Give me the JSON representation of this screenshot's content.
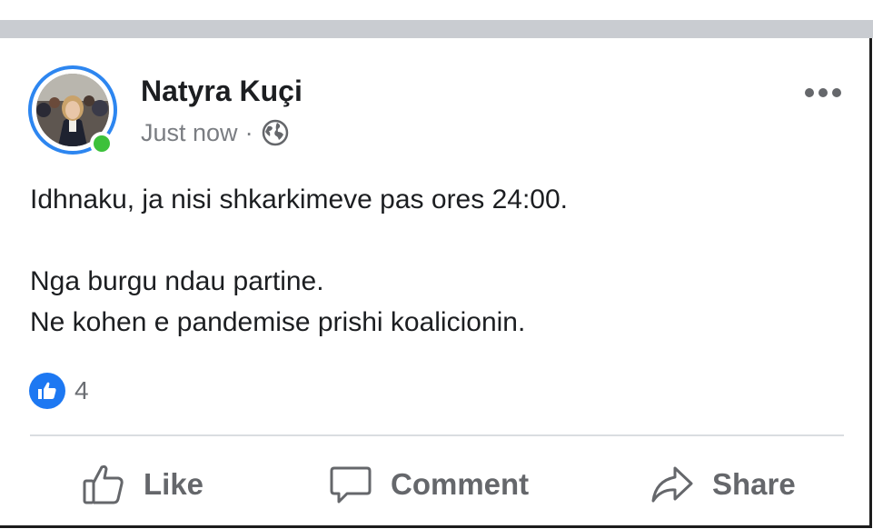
{
  "post": {
    "author": "Natyra Kuçi",
    "timestamp": "Just now",
    "separator": "·",
    "audience_icon": "globe-icon",
    "online_status": true,
    "text_line_1": "Idhnaku, ja nisi shkarkimeve pas ores 24:00.",
    "text_line_2": "Nga burgu ndau partine.",
    "text_line_3": "Ne kohen e pandemise prishi koalicionin.",
    "reaction_icon": "like-icon",
    "reaction_count": "4"
  },
  "actions": {
    "like_label": "Like",
    "comment_label": "Comment",
    "share_label": "Share"
  },
  "colors": {
    "accent_blue": "#1d78f2",
    "online_green": "#3cc13b",
    "secondary_text": "#65676b"
  }
}
